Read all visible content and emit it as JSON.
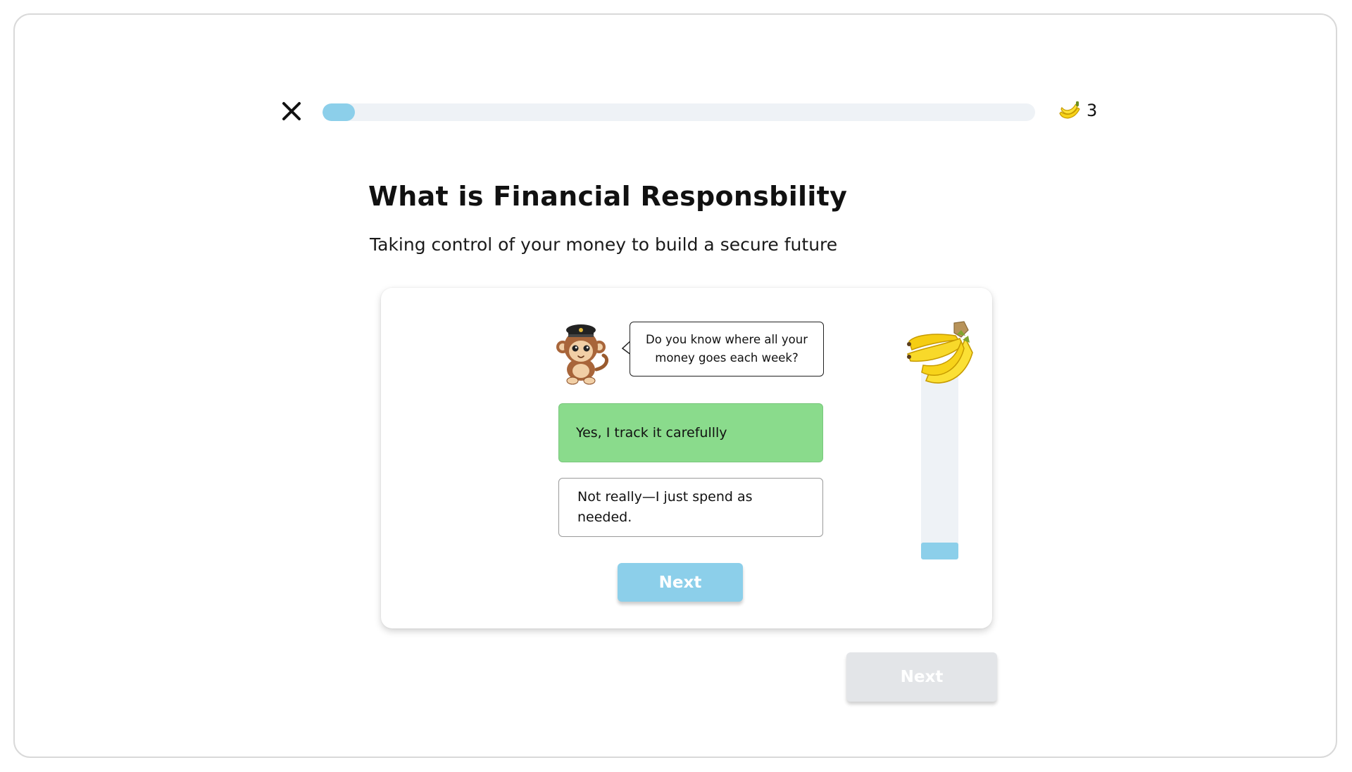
{
  "header": {
    "progress_fraction": 0.045,
    "banana_count": "3"
  },
  "lesson": {
    "title": "What is Financial Responsbility",
    "subtitle": "Taking control of your money to build a secure future"
  },
  "card": {
    "question": "Do you know where all your money goes each week?",
    "options": [
      {
        "label": "Yes, I track it carefullly",
        "selected": true
      },
      {
        "label": "Not really—I just spend as needed.",
        "selected": false
      }
    ],
    "next_label": "Next",
    "banana_meter_fraction": 0.09
  },
  "footer": {
    "next_label": "Next",
    "next_enabled": false
  },
  "colors": {
    "accent": "#8ccfea",
    "selected_option": "#8adb8c",
    "track": "#eef2f6",
    "disabled_button": "#e3e5e8"
  },
  "icons": {
    "close": "close-icon",
    "banana": "banana-icon",
    "mascot": "monkey-captain-mascot"
  }
}
